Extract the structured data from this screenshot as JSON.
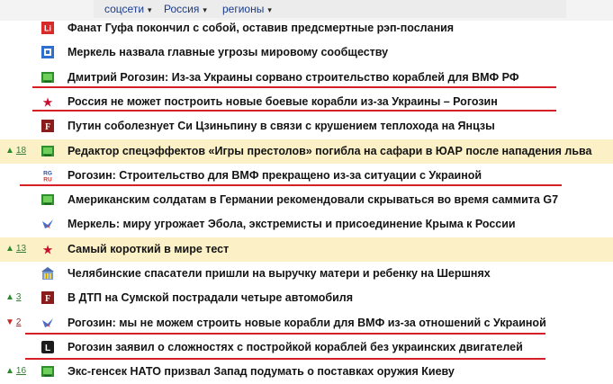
{
  "filters": [
    {
      "label": "соцсети",
      "caret": "▾"
    },
    {
      "label": "Россия",
      "caret": "▾"
    },
    {
      "label": "регионы",
      "caret": "▾"
    }
  ],
  "news": [
    {
      "icon": "source-li-red-icon",
      "headline": "Фанат Гуфа покончил с собой, оставив предсмертные рэп-послания",
      "highlighted": false
    },
    {
      "icon": "source-blue-square-icon",
      "headline": "Меркель назвала главные угрозы мировому сообществу",
      "highlighted": false
    },
    {
      "icon": "source-tv-green-icon",
      "headline": "Дмитрий Рогозин: Из-за Украины сорвано строительство кораблей для ВМФ РФ",
      "highlighted": false
    },
    {
      "icon": "source-red-star-icon",
      "headline": "Россия не может построить новые боевые корабли из-за Украины – Рогозин",
      "highlighted": false
    },
    {
      "icon": "source-f-maroon-icon",
      "headline": "Путин соболезнует Си Цзиньпину в связи с крушением теплохода на Янцзы",
      "highlighted": false
    },
    {
      "icon": "source-tv-green-icon",
      "headline": "Редактор спецэффектов «Игры престолов» погибла на сафари в ЮАР после нападения льва",
      "highlighted": true,
      "delta": {
        "dir": "up",
        "arrow": "▲",
        "value": "18"
      }
    },
    {
      "icon": "source-rg-ru-icon",
      "icon_text_top": "RG",
      "icon_text_bottom": "RU",
      "headline": "Рогозин: Строительство для ВМФ прекращено из-за ситуации с Украиной",
      "highlighted": false
    },
    {
      "icon": "source-tv-green-icon",
      "headline": "Американским солдатам в Германии рекомендовали скрываться во время саммита G7",
      "highlighted": false
    },
    {
      "icon": "source-bird-blue-icon",
      "headline": "Меркель: миру угрожает Эбола, экстремисты и присоединение Крыма к России",
      "highlighted": false
    },
    {
      "icon": "source-red-star-icon",
      "headline": "Самый короткий в мире тест",
      "highlighted": true,
      "delta": {
        "dir": "up",
        "arrow": "▲",
        "value": "13"
      }
    },
    {
      "icon": "source-building-icon",
      "headline": "Челябинские спасатели пришли на выручку матери и ребенку на Шершнях",
      "highlighted": false
    },
    {
      "icon": "source-f-maroon-icon",
      "headline": "В ДТП на Сумской пострадали четыре автомобиля",
      "highlighted": false,
      "delta": {
        "dir": "up",
        "arrow": "▲",
        "value": "3"
      }
    },
    {
      "icon": "source-bird-blue-icon",
      "headline": "Рогозин: мы не можем строить новые корабли для ВМФ из-за отношений с Украиной",
      "highlighted": false,
      "delta": {
        "dir": "down",
        "arrow": "▼",
        "value": "2"
      }
    },
    {
      "icon": "source-l-black-icon",
      "icon_text_top": "L",
      "headline": "Рогозин заявил о сложностях с постройкой кораблей без украинских двигателей",
      "highlighted": false
    },
    {
      "icon": "source-tv-green-icon",
      "headline": "Экс-генсек НАТО призвал Запад подумать о поставках оружия Киеву",
      "highlighted": false,
      "delta": {
        "dir": "up",
        "arrow": "▲",
        "value": "16"
      }
    }
  ],
  "icon_glyphs": {
    "li": "Li",
    "tv": "",
    "f": "F",
    "star": "★"
  },
  "colors": {
    "highlight_row": "#fbf0c6",
    "annotation_underline": "#d61f26",
    "link_filter": "#1a3c8c",
    "delta_up": "#2d8a2d",
    "delta_down": "#c62828"
  }
}
